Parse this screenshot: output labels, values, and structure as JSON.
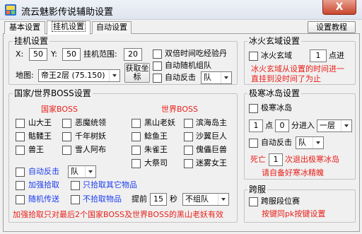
{
  "window": {
    "title": "流云魅影传说辅助设置",
    "close_label": "X"
  },
  "tabs": [
    {
      "label": "基本设置"
    },
    {
      "label": "挂机设置"
    },
    {
      "label": "自动设置"
    }
  ],
  "help_button": "设置教程",
  "hangup": {
    "title": "挂机设置",
    "x_label": "X:",
    "x_value": "50",
    "y_label": "Y:",
    "y_value": "50",
    "range_label": "挂机范围:",
    "range_value": "20",
    "map_label": "地图:",
    "map_value": "帝王2层 (75.150)",
    "get_coords_button": "获取坐标",
    "double_exp_label": "双倍时间吃经验丹",
    "auto_random_label": "自动随机组队",
    "auto_counter_label": "自动反击",
    "auto_counter_value": "队"
  },
  "boss": {
    "title": "国家/世界BOSS设置",
    "country_header": "国家BOSS",
    "world_header": "世界BOSS",
    "country_col1": [
      "山大王",
      "骷髅王",
      "兽王"
    ],
    "country_col2": [
      "恶魔统领",
      "千年树妖",
      "雪人阿布"
    ],
    "world_col1": [
      "黑山老妖",
      "鲶鱼王",
      "朱雀王",
      "大祭司"
    ],
    "world_col2": [
      "滨海岛主",
      "沙翼巨人",
      "傀儡巨兽",
      "迷雾女王"
    ],
    "auto_counter_label": "自动反击",
    "auto_counter_value": "队",
    "boost_pickup_label": "加强拾取",
    "pickup_other_label": "只拾取其它物品",
    "random_send_label": "随机传送",
    "no_pickup_label": "不拾取物品",
    "advance_label": "提前",
    "advance_value": "15",
    "seconds_label": "秒",
    "no_team_value": "不组队",
    "footer_note": "加强拾取只对最后2个国家BOSS及世界BOSS的黑山老妖有效"
  },
  "firewater": {
    "title": "冰火玄域设置",
    "check_label": "冰火玄域",
    "points_value": "1",
    "points_label": "点进",
    "note": "冰火玄域从设置的时间进一直挂到没时间了为止"
  },
  "icecave": {
    "title": "极寒冰岛设置",
    "check_label": "极寒冰岛",
    "hour_value": "1",
    "hour_label": "点",
    "minute_value": "0",
    "minute_label": "分进入",
    "floor_value": "一层",
    "auto_counter_label": "自动反击",
    "auto_counter_value": "队",
    "death_label": "死亡",
    "death_value": "1",
    "exit_label": "次退出极寒冰岛",
    "prep_note": "请自备好寒冰精魄"
  },
  "crossserver": {
    "title": "跨服",
    "check_label": "跨服段位赛",
    "note": "按键同pk按键设置"
  }
}
